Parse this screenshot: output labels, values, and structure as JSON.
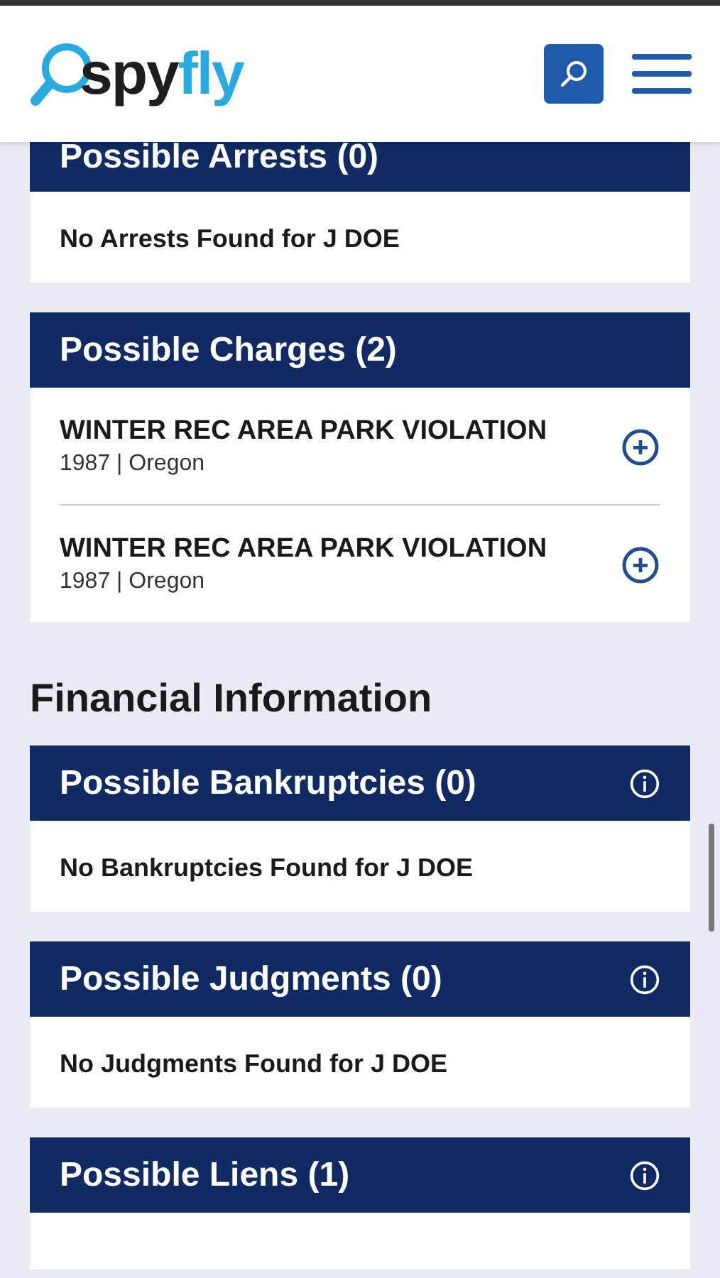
{
  "header": {
    "logo": [
      "spy",
      "fly"
    ]
  },
  "sections": [
    {
      "kind": "card",
      "title": "Possible Arrests (0)",
      "info": false,
      "message": "No Arrests Found for J DOE"
    },
    {
      "kind": "card",
      "title": "Possible Charges (2)",
      "info": false,
      "records": [
        {
          "title": "WINTER REC AREA PARK VIOLATION",
          "details": "1987 | Oregon",
          "expanded": false
        },
        {
          "title": "WINTER REC AREA PARK VIOLATION",
          "details": "1987 | Oregon",
          "expanded": false
        }
      ]
    },
    {
      "kind": "heading",
      "title": "Financial Information"
    },
    {
      "kind": "card",
      "title": "Possible Bankruptcies (0)",
      "info": true,
      "message": "No Bankruptcies Found for J DOE"
    },
    {
      "kind": "card",
      "title": "Possible Judgments (0)",
      "info": true,
      "message": "No Judgments Found for J DOE"
    },
    {
      "kind": "card",
      "title": "Possible Liens (1)",
      "info": true
    }
  ]
}
